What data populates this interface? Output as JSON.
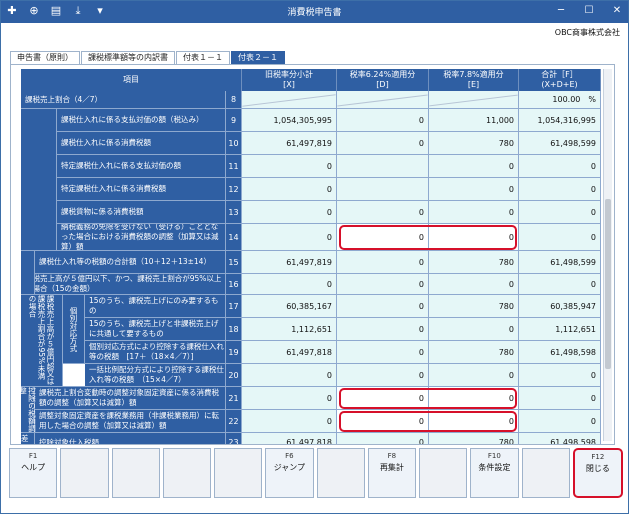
{
  "window": {
    "title": "消費税申告書",
    "company": "OBC商事株式会社"
  },
  "tabs": [
    {
      "label": "申告書（原則）",
      "active": false
    },
    {
      "label": "課税標準額等の内訳書",
      "active": false
    },
    {
      "label": "付表１－１",
      "active": false
    },
    {
      "label": "付表２－１",
      "active": true
    }
  ],
  "table": {
    "headers": {
      "item": "項目",
      "x": [
        "旧税率分小計",
        "[X]"
      ],
      "d": [
        "税率6.24%適用分",
        "[D]"
      ],
      "e": [
        "税率7.8%適用分",
        "[E]"
      ],
      "total": [
        "合計［F］",
        "(X+D+E)"
      ]
    },
    "rows": [
      {
        "no": "8",
        "label": "課税売上割合（4／7）",
        "x": "",
        "d": "",
        "e": "",
        "f": "100.00　%",
        "highlight": false
      },
      {
        "no": "9",
        "label": "課税仕入れに係る支払対価の額（税込み）",
        "x": "1,054,305,995",
        "d": "0",
        "e": "11,000",
        "f": "1,054,316,995",
        "highlight": false
      },
      {
        "no": "10",
        "label": "課税仕入れに係る消費税額",
        "x": "61,497,819",
        "d": "0",
        "e": "780",
        "f": "61,498,599",
        "highlight": false
      },
      {
        "no": "11",
        "label": "特定課税仕入れに係る支払対価の額",
        "x": "0",
        "d": "",
        "e": "0",
        "f": "0",
        "highlight": false
      },
      {
        "no": "12",
        "label": "特定課税仕入れに係る消費税額",
        "x": "0",
        "d": "",
        "e": "0",
        "f": "0",
        "highlight": false
      },
      {
        "no": "13",
        "label": "課税貨物に係る消費税額",
        "x": "0",
        "d": "0",
        "e": "0",
        "f": "0",
        "highlight": false
      },
      {
        "no": "14",
        "label": "納税義務の免除を受けない（受ける）こととなった場合における消費税額の調整（加算又は減算）額",
        "x": "0",
        "d": "0",
        "e": "0",
        "f": "0",
        "highlight": true
      },
      {
        "no": "15",
        "label": "課税仕入れ等の税額の合計額（10＋12＋13±14）",
        "x": "61,497,819",
        "d": "0",
        "e": "780",
        "f": "61,498,599",
        "highlight": false
      },
      {
        "no": "16",
        "label": "課税売上高が５億円以下、かつ、課税売上割合が95%以上の場合（15の金額）",
        "x": "0",
        "d": "0",
        "e": "0",
        "f": "0",
        "highlight": false
      },
      {
        "no": "17",
        "label": "15のうち、課税売上げにのみ要するもの",
        "x": "60,385,167",
        "d": "0",
        "e": "780",
        "f": "60,385,947",
        "highlight": false
      },
      {
        "no": "18",
        "label": "15のうち、課税売上げと非課税売上げに共通して要するもの",
        "x": "1,112,651",
        "d": "0",
        "e": "0",
        "f": "1,112,651",
        "highlight": false
      },
      {
        "no": "19",
        "label": "個別対応方式により控除する課税仕入れ等の税額　[17＋（18×4／7）]",
        "x": "61,497,818",
        "d": "0",
        "e": "780",
        "f": "61,498,598",
        "highlight": false
      },
      {
        "no": "20",
        "label": "一括比例配分方式により控除する課税仕入れ等の税額　（15×4／7）",
        "x": "0",
        "d": "0",
        "e": "0",
        "f": "0",
        "highlight": false
      },
      {
        "no": "21",
        "label": "課税売上割合変動時の調整対象固定資産に係る消費税額の調整（加算又は減算）額",
        "x": "0",
        "d": "0",
        "e": "0",
        "f": "0",
        "highlight": true
      },
      {
        "no": "22",
        "label": "調整対象固定資産を課税業務用（非課税業務用）に転用した場合の調整（加算又は減算）額",
        "x": "0",
        "d": "0",
        "e": "0",
        "f": "0",
        "highlight": true
      },
      {
        "no": "23",
        "label": "控除対象仕入税額",
        "x": "61,497,818",
        "d": "0",
        "e": "780",
        "f": "61,498,598",
        "highlight": false
      }
    ],
    "side_groups": {
      "over95": "課税売上高が５億円超又は課税売上割合が95%未満の場合",
      "kobetsu": "個別対応方式",
      "adjust": "控除の税額調整",
      "sa": "差引"
    }
  },
  "fkeys": [
    {
      "key": "F1",
      "label": "ヘルプ",
      "enabled": true
    },
    {
      "key": "",
      "label": "",
      "enabled": false
    },
    {
      "key": "",
      "label": "",
      "enabled": false
    },
    {
      "key": "",
      "label": "",
      "enabled": false
    },
    {
      "key": "",
      "label": "",
      "enabled": false
    },
    {
      "key": "F6",
      "label": "ジャンプ",
      "enabled": true
    },
    {
      "key": "",
      "label": "",
      "enabled": false
    },
    {
      "key": "F8",
      "label": "再集計",
      "enabled": true
    },
    {
      "key": "",
      "label": "",
      "enabled": false
    },
    {
      "key": "F10",
      "label": "条件設定",
      "enabled": true
    },
    {
      "key": "",
      "label": "",
      "enabled": false
    },
    {
      "key": "F12",
      "label": "閉じる",
      "enabled": true,
      "highlight": true
    }
  ],
  "colors": {
    "header": "#2f5fa3",
    "cell": "#e5f7f7",
    "highlight": "#d6102a"
  }
}
